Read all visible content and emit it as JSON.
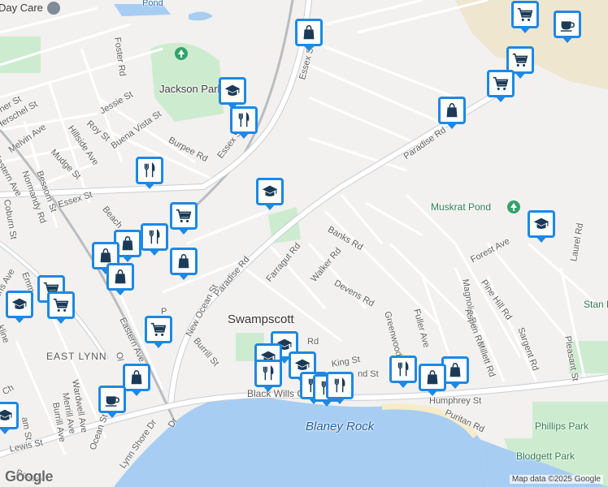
{
  "map": {
    "attribution": "Map data ©2025 Google",
    "logo": "Google",
    "colors": {
      "land": "#f2f1ef",
      "water": "#a7cdf2",
      "park": "#cdeccf",
      "road_major": "#ffffff",
      "road_minor": "#ffffff",
      "road_edge": "#c9cdd3",
      "railway": "#b9bcc0",
      "beach": "#f6ecc9",
      "pin_border": "#1e88e5",
      "pin_icon": "#1b3a57"
    },
    "places": {
      "town": "Swampscott",
      "area": "EAST LYNN",
      "day_care": "Day Care",
      "pond_top": "Pond",
      "jackson_park": "Jackson Park",
      "muskrat_pond": "Muskrat Pond",
      "black_wills_cliff": "Black Wills Cliff",
      "blaney_rock": "Blaney Rock",
      "phillips_park": "Phillips Park",
      "blodgett_park": "Blodgett Park",
      "stan_re": "Stan Re"
    },
    "streets": {
      "foster": "Foster Rd",
      "essex_st_upper": "Essex St",
      "essex_st_mid": "Essex St",
      "essex_st_left": "Essex St",
      "jessie": "Jessie St",
      "roy": "Roy St",
      "herschel": "Herschel St",
      "melvin": "Melvin Ave",
      "hillside": "Hillside Ave",
      "buena_vista": "Buena Vista St",
      "burpee": "Burpee Rd",
      "mudge": "Mudge St",
      "eastern_ave_left": "Eastern Ave",
      "normandy": "Normandy Rd",
      "bessom": "Bessom St",
      "coburn": "Coburn St",
      "beach": "Beach",
      "paradise_rd_upper": "Paradise Rd",
      "paradise_rd_lower": "Paradise Rd",
      "banks": "Banks Rd",
      "farragut": "Farragut Rd",
      "walker": "Walker Rd",
      "devens": "Devens Rd",
      "forest": "Forest Ave",
      "magnolia": "Magnolia Rd",
      "pine_hill": "Pine Hill Rd",
      "laurel": "Laurel Rd",
      "aspen": "Aspen Rd",
      "millett": "Millett Rd",
      "sargent": "Sargent Rd",
      "pleasant": "Pleasant St",
      "fuller": "Fuller Ave",
      "greenwood": "Greenwood",
      "eastern_ave_mid": "Eastern Ave",
      "new_ocean": "New Ocean St",
      "burrill": "Burrill St",
      "king": "King St",
      "humphrey": "Humphrey St",
      "puritan": "Puritan Rd",
      "lewis": "Lewis St",
      "ocean": "Ocean St",
      "lynn_shore": "Lynn Shore Dr",
      "wardwell": "Wardwell Ave",
      "merrill": "Merrill Ave",
      "burrill_ave": "Burrill Ave",
      "emm": "Emm",
      "ens_ave": "ens Ave",
      "kline": "kline",
      "basset": "Basset",
      "ch": "Ch",
      "am_st": "am St",
      "dr": "Dr",
      "rd_small": "Rd",
      "nd_st": "nd St",
      "op": "Ol",
      "ner_st": "ner St",
      "pr": "P"
    },
    "pins": [
      {
        "type": "shopping-bag",
        "label": "shopping"
      },
      {
        "type": "coffee",
        "label": "cafe"
      },
      {
        "type": "grocery-cart",
        "label": "grocery"
      },
      {
        "type": "school",
        "label": "school"
      },
      {
        "type": "restaurant",
        "label": "restaurant"
      }
    ]
  }
}
